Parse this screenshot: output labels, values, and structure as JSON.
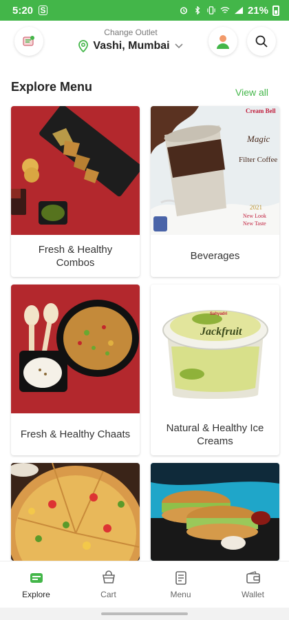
{
  "status_bar": {
    "time": "5:20",
    "left_icon": "S",
    "battery": "21%",
    "icons": [
      "alarm-icon",
      "bluetooth-icon",
      "vibrate-icon",
      "wifi-icon",
      "signal-icon"
    ]
  },
  "header": {
    "logo_icon": "brand-logo-icon",
    "outlet_label": "Change Outlet",
    "outlet_name": "Vashi, Mumbai",
    "location_icon": "location-pin-icon",
    "dropdown_icon": "chevron-down-icon",
    "avatar_icon": "user-avatar-icon",
    "search_icon": "search-icon"
  },
  "section": {
    "title": "Explore Menu",
    "view_all": "View all"
  },
  "categories": [
    {
      "label": "Fresh & Healthy Combos",
      "image": "combo-platter"
    },
    {
      "label": "Beverages",
      "image": "cold-coffee-cup"
    },
    {
      "label": "Fresh &  Healthy Chaats",
      "image": "chaat-bowl"
    },
    {
      "label": "Natural & Healthy Ice Creams",
      "image": "jackfruit-ice-cream-tub"
    },
    {
      "label": "",
      "image": "pizza"
    },
    {
      "label": "",
      "image": "sandwich"
    }
  ],
  "promo_text": {
    "brand": "Cream Bell",
    "line1": "Magic",
    "line2": "Filter Coffee",
    "year": "2021",
    "tag1": "New Look",
    "tag2": "New Taste"
  },
  "tub_text": {
    "brand": "Sahyadri",
    "flavor": "Jackfruit"
  },
  "bottom_nav": [
    {
      "label": "Explore",
      "icon": "explore-icon",
      "active": true
    },
    {
      "label": "Cart",
      "icon": "cart-icon",
      "active": false
    },
    {
      "label": "Menu",
      "icon": "menu-icon",
      "active": false
    },
    {
      "label": "Wallet",
      "icon": "wallet-icon",
      "active": false
    }
  ],
  "colors": {
    "accent": "#43b649",
    "status_bar": "#43b649",
    "combo_bg": "#b3282d",
    "chaat_bg": "#b3282d",
    "sandwich_bg": "#1fa6c9"
  }
}
